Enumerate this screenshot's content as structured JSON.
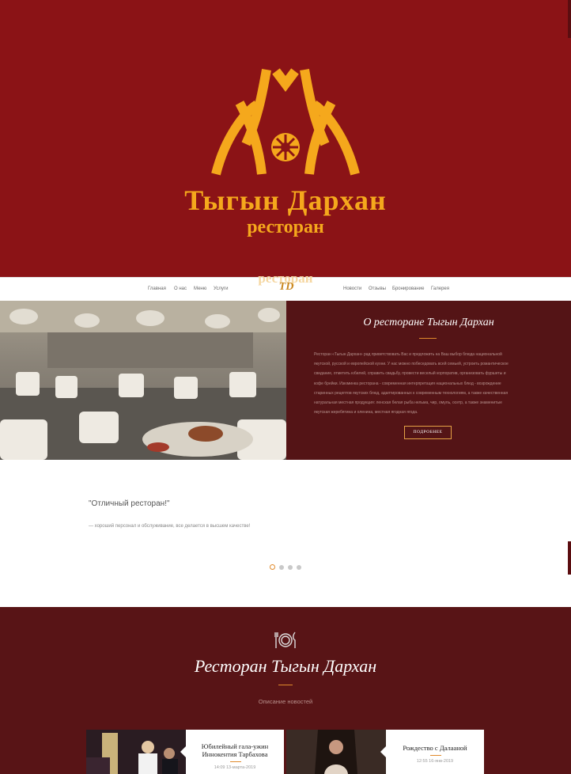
{
  "hero": {
    "title": "Тыгын Дархан",
    "subtitle": "ресторан",
    "bg_color": "#8b1316",
    "accent": "#f5a81c"
  },
  "nav": {
    "left": [
      "Главная",
      "О нас",
      "Меню",
      "Услуги"
    ],
    "right": [
      "Новости",
      "Отзывы",
      "Бронирование",
      "Галерея"
    ],
    "logo_back": "ресторан",
    "logo": "TD"
  },
  "about": {
    "title": "О ресторане Тыгын Дархан",
    "lines": [
      "Ресторан «Тыгын Дархан» рад приветствовать Вас и предложить на Ваш выбор блюда национальной",
      "якутской, русской и европейской кухни. У нас можно побеседовать всей семьей, устроить романтическое",
      "свидание, отметить юбилей, справить свадьбу, провести веселый корпоратив, организовать фуршеты и",
      "кофе брейки. Изюминка ресторана - современная интерпретация национальных блюд - возрождение",
      "старинных рецептов якутских блюд, адаптированных к современным технологиям, а также качественная",
      "натуральная местная продукция: ленская белая рыба нельма, чир, омуль, осетр, а также знаменитые",
      "якутская жеребятина и оленина, местная ягодная ягода."
    ],
    "button": "ПОДРОБНЕЕ"
  },
  "review": {
    "quote": "\"Отличный ресторан!\"",
    "text": "— хороший персонал и обслуживание, все делается в высшем качестве!",
    "dots": 4,
    "active_dot": 0
  },
  "news": {
    "icon": "plate-fork-knife-icon",
    "title": "Ресторан Тыгын Дархан",
    "subtitle": "Описание новостей",
    "cards": [
      {
        "title_line1": "Юбилейный гала-ужин",
        "title_line2": "Иннокентия Тарбахова",
        "date": "14:09 13-марта-2019"
      },
      {
        "title_line1": "Рождество с Далааной",
        "title_line2": "",
        "date": "12:55 16-янв-2019"
      }
    ]
  },
  "colors": {
    "dark_red": "#541416",
    "orange": "#e08a2c"
  }
}
